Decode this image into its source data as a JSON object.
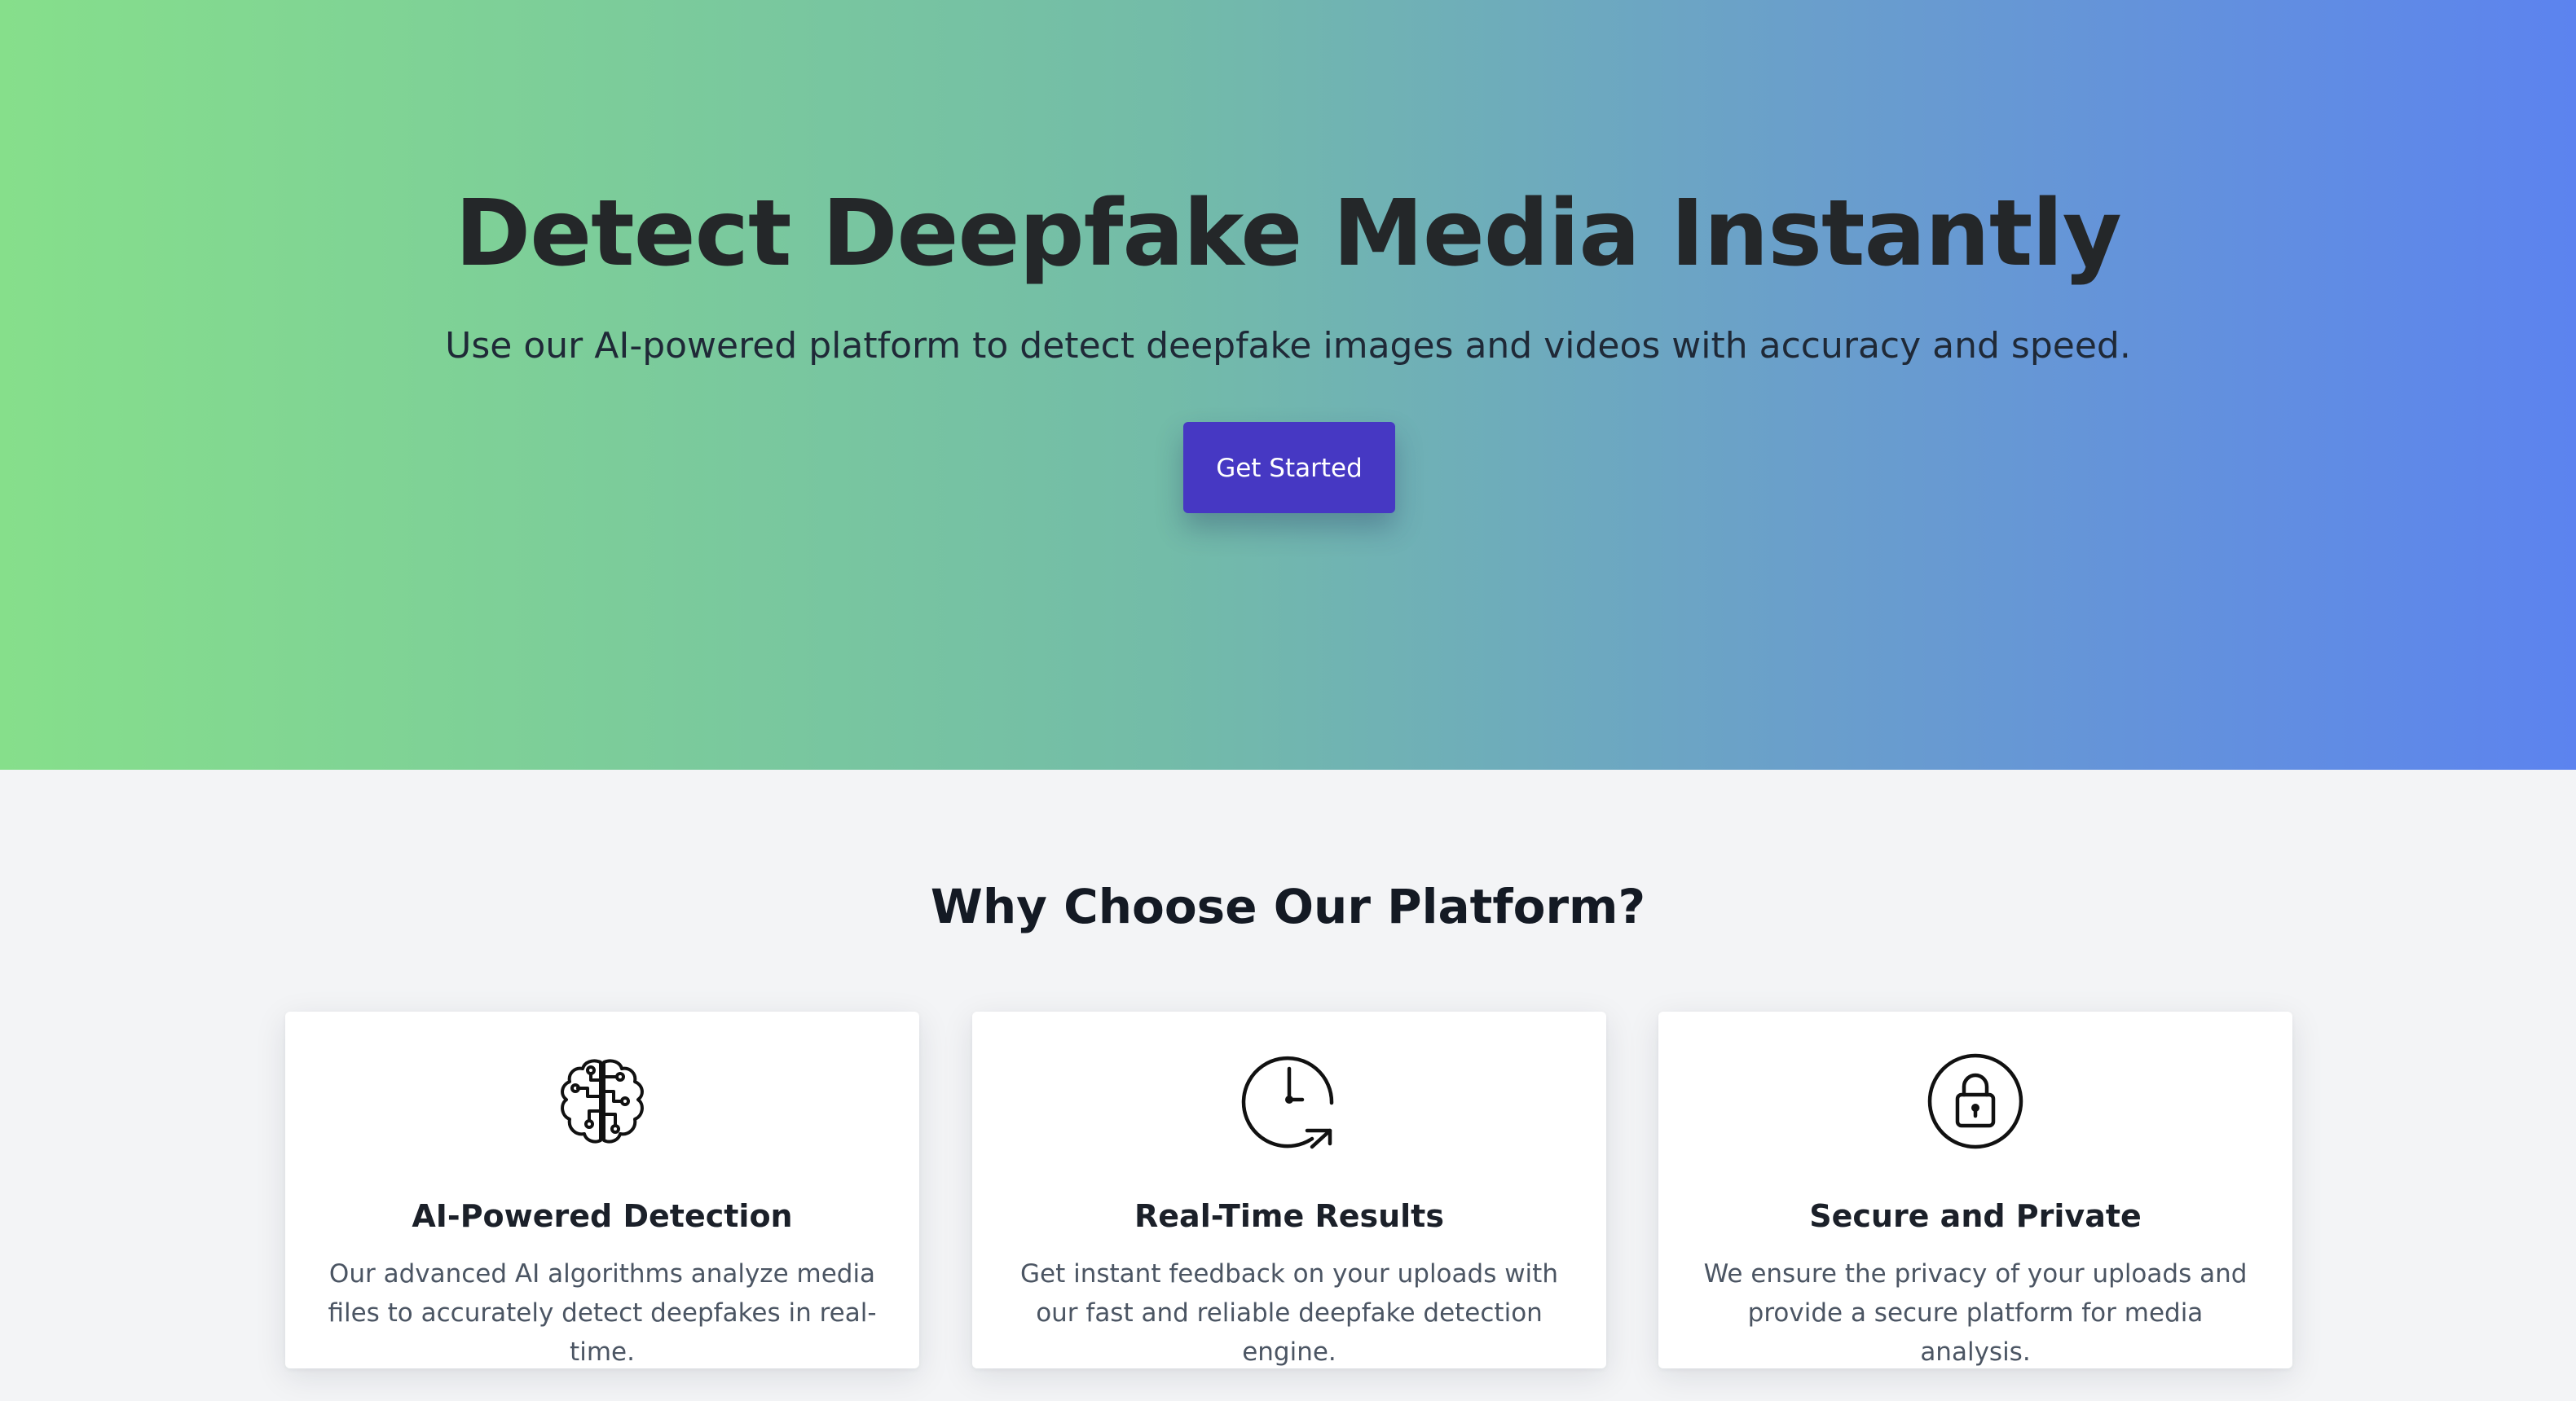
{
  "hero": {
    "title": "Detect Deepfake Media Instantly",
    "subtitle": "Use our AI-powered platform to detect deepfake images and videos with accuracy and speed.",
    "cta_label": "Get Started"
  },
  "features": {
    "heading": "Why Choose Our Platform?",
    "cards": [
      {
        "icon": "brain-circuit-icon",
        "title": "AI-Powered Detection",
        "description": "Our advanced AI algorithms analyze media files to accurately detect deepfakes in real-time."
      },
      {
        "icon": "clock-refresh-icon",
        "title": "Real-Time Results",
        "description": "Get instant feedback on your uploads with our fast and reliable deepfake detection engine."
      },
      {
        "icon": "lock-icon",
        "title": "Secure and Private",
        "description": "We ensure the privacy of your uploads and provide a secure platform for media analysis."
      }
    ]
  },
  "colors": {
    "gradient_start": "#86df8b",
    "gradient_end": "#5c83ef",
    "cta_background": "#4638c3",
    "page_background": "#f3f4f6"
  }
}
